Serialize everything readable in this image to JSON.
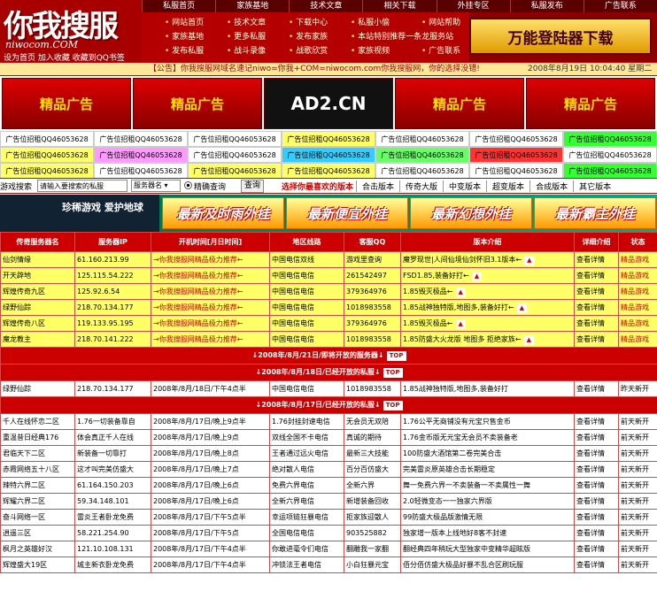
{
  "header": {
    "logo_text": "你我搜服",
    "logo_domain": "niwocom.COM",
    "logo_links": "设为首页  加入收藏  收藏到QQ书签",
    "topnav": [
      "私服首页",
      "家族基地",
      "技术文章",
      "相关下载",
      "外挂专区",
      "私服发布",
      "广告联系"
    ],
    "subnav_cols": [
      [
        "网站首页",
        "家族基地",
        "发布私服"
      ],
      [
        "技术文章",
        "更多私服",
        "战斗录像"
      ],
      [
        "下载中心",
        "发布家族",
        "战歌欣赏"
      ],
      [
        "私服小偷",
        "本站特别推荐一条龙服务站",
        "家族视频"
      ],
      [
        "网站帮助",
        "",
        "广告联系"
      ]
    ],
    "download_banner": "万能登陆器下载"
  },
  "notice": {
    "text": "【公告】你我搜服网域名速记niwo=你我+COM=niwocom.com你我搜服网，你的选择没错!",
    "datetime": "2008年8月19日  10:04:40  星期二"
  },
  "banners": [
    "精品广告",
    "精品广告",
    "AD2.CN",
    "精品广告",
    "精品广告"
  ],
  "ad_rows": [
    [
      {
        "t": "广告位招租QQ46053628",
        "c": "#fff"
      },
      {
        "t": "广告位招租QQ46053628",
        "c": "#fff"
      },
      {
        "t": "广告位招租QQ46053628",
        "c": "#fff"
      },
      {
        "t": "广告位招租QQ46053628",
        "c": "#ffff66"
      },
      {
        "t": "广告位招租QQ46053628",
        "c": "#fff"
      },
      {
        "t": "广告位招租QQ46053628",
        "c": "#fff"
      },
      {
        "t": "广告位招租QQ46053628",
        "c": "#33ff33"
      }
    ],
    [
      {
        "t": "广告位招租QQ46053628",
        "c": "#ffff66"
      },
      {
        "t": "广告位招租QQ46053628",
        "c": "#ff99ff"
      },
      {
        "t": "广告位招租QQ46053628",
        "c": "#fff"
      },
      {
        "t": "广告位招租QQ46053628",
        "c": "#33ccff"
      },
      {
        "t": "广告位招租QQ46053628",
        "c": "#66ff66"
      },
      {
        "t": "广告位招租QQ46053628",
        "c": "#ff3333"
      },
      {
        "t": "广告位招租QQ46053628",
        "c": "#fff"
      }
    ],
    [
      {
        "t": "广告位招租QQ46053628",
        "c": "#ffff66"
      },
      {
        "t": "广告位招租QQ46053628",
        "c": "#fff"
      },
      {
        "t": "广告位招租QQ46053628",
        "c": "#ffff66"
      },
      {
        "t": "广告位招租QQ46053628",
        "c": "#ffff66"
      },
      {
        "t": "广告位招租QQ46053628",
        "c": "#fff"
      },
      {
        "t": "广告位招租QQ46053628",
        "c": "#fff"
      },
      {
        "t": "广告位招租QQ46053628",
        "c": "#33ff33"
      }
    ]
  ],
  "search": {
    "label": "游戏搜索",
    "placeholder": "请输入要搜索的私服",
    "select_value": "服务器名",
    "exact_label": "精确查询",
    "button": "查询",
    "version_prompt": "选择你最喜欢的版本",
    "versions": [
      "合击版本",
      "传奇大版",
      "中变版本",
      "超变版本",
      "合成版本",
      "其它版本"
    ]
  },
  "promo": {
    "left": "珍稀游戏 爱护地球",
    "banners": [
      "最新及时雨外挂",
      "最新便宜外挂",
      "最新幻想外挂",
      "最新霸主外挂"
    ]
  },
  "table": {
    "headers": [
      "传奇服务器名",
      "服务器IP",
      "开机时间[月日时间]",
      "地区线路",
      "客服QQ",
      "版本介绍",
      "详细介绍",
      "状态"
    ],
    "hot_rows": [
      [
        "仙剑情缘",
        "61.160.213.99",
        "→你我搜服网精品极力推荐←",
        "中国电信双线",
        "游戏里查询",
        "魔罗现世|人间仙境仙剑怀旧3.1版本←",
        "查看详情",
        "精品游戏"
      ],
      [
        "开天辟地",
        "125.115.54.222",
        "→你我搜服网精品极力推荐←",
        "中国电信电信",
        "261542497",
        "FSD1.85,装备好打←",
        "查看详情",
        "精品游戏"
      ],
      [
        "辉煌传奇九区",
        "125.92.6.54",
        "→你我搜服网精品极力推荐←",
        "中国电信电信",
        "379364976",
        "1.85毁灭极品←",
        "查看详情",
        "精品游戏"
      ],
      [
        "绿野仙踪",
        "218.70.134.177",
        "→你我搜服网精品极力推荐←",
        "中国电信电信",
        "1018983558",
        "1.85战神独特版,地图多,装备好打←",
        "查看详情",
        "精品游戏"
      ],
      [
        "辉煌传奇八区",
        "119.133.95.195",
        "→你我搜服网精品极力推荐←",
        "中国电信电信",
        "379364976",
        "1.85毁灭极品←",
        "查看详情",
        "精品游戏"
      ],
      [
        "魔龙教主",
        "218.70.141.222",
        "→你我搜服网精品极力推荐←",
        "中国电信电信",
        "1018983558",
        "1.85防盛大火龙版 地图多 拒绝家族←",
        "查看详情",
        "精品游戏"
      ]
    ],
    "div1": "↓2008年/8月/21日/即将开放的服务器↓",
    "div2": "↓2008年/8月/18日/已经开放的私服↓",
    "group2": [
      [
        "绿野仙踪",
        "218.70.134.177",
        "2008年/8月/18日/下午4点半",
        "中国电信电信",
        "1018983558",
        "1.85战神独特版,地图多,装备好打",
        "查看详情",
        "昨天新开"
      ]
    ],
    "div3": "↓2008年/8月/17日/已经开放的私服↓",
    "group3": [
      [
        "千人在线怀恋二区",
        "1.76一切装备靠自",
        "2008年/8月/17日/晚上9点半",
        "1.76封挂封速电信",
        "无会员无双陪",
        "1.76公平无商铺没有元宝只售金币",
        "查看详情",
        "前天新开"
      ],
      [
        "重温昔日经典176",
        "体会真正千人在线",
        "2008年/8月/17日/晚上9点",
        "双线全国不卡电信",
        "真诚的期待",
        "1.76金币版无元宝无会员不卖装备老",
        "查看详情",
        "前天新开"
      ],
      [
        "君临天下二区",
        "新装备一切靠打",
        "2008年/8月/17日/晚上8点",
        "王者通过远火电信",
        "最新三大技能",
        "100防盛大酒馆第二卷完美合击",
        "查看详情",
        "前天新开"
      ],
      [
        "赤霞网络五十八区",
        "这才叫完美仿盛大",
        "2008年/8月/17日/晚上7点",
        "绝对散人电信",
        "百分百仿盛大",
        "完美雷炎原英雄合击长期稳定",
        "查看详情",
        "前天新开"
      ],
      [
        "辣特六界二区",
        "61.164.150.203",
        "2008年/8月/17日/晚上6点",
        "免费六界电信",
        "全新六界",
        "舞一免费六界一不卖装备一不卖属性一舞",
        "查看详情",
        "前天新开"
      ],
      [
        "辉耀六界二区",
        "59.34.148.101",
        "2008年/8月/17日/晚上6点",
        "全新六界电信",
        "新增装备回收",
        "2.0轻微变态一一独家六界版",
        "查看详情",
        "前天新开"
      ],
      [
        "奋斗网络一区",
        "雷炎王者卧龙免费",
        "2008年/8月/17日/下午5点半",
        "幸运项链狂暴电信",
        "拒家族迎散人",
        "99防盛大极品版激情无限",
        "查看详情",
        "前天新开"
      ],
      [
        "逍遥三区",
        "58.221.254.90",
        "2008年/8月/17日/下午5点",
        "全国电信电信",
        "903525882",
        "独家增一版本上线地好8客不封速",
        "查看详情",
        "前天新开"
      ],
      [
        "枫月之英雄好汉",
        "121.10.108.131",
        "2008年/8月/17日/下午4点半",
        "你敢进毫令们电信",
        "翻雕我一家翻",
        "翻经典四年稍玩大型独家中变精华超眩版",
        "查看详情",
        "前天新开"
      ],
      [
        "辉煌盛大19区",
        "城主新衣卧龙免费",
        "2008年/8月/17日/下午4点半",
        "冲锁法王者电信",
        "小白狂暴元宝",
        "佰分佰仿盛大极品好暴不乱合区刷玩服",
        "查看详情",
        "前天新开"
      ]
    ]
  }
}
